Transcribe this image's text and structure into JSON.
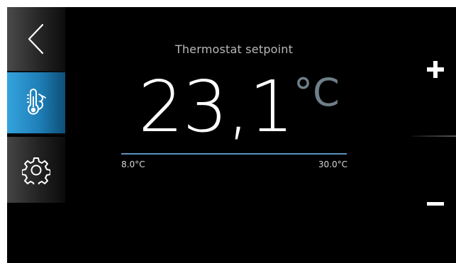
{
  "sidebar": {
    "items": [
      {
        "icon": "back-chevron-icon",
        "active": false
      },
      {
        "icon": "thermostat-icon",
        "active": true
      },
      {
        "icon": "gear-icon",
        "active": false
      }
    ]
  },
  "setpoint": {
    "title": "Thermostat setpoint",
    "value": "23,1",
    "unit": "°C",
    "min_label": "8.0°C",
    "max_label": "30.0°C"
  },
  "controls": {
    "increase_icon": "plus-icon",
    "decrease_icon": "minus-icon"
  },
  "colors": {
    "active_accent": "#2a8fcb",
    "unit_color": "#6f7f89",
    "range_track": "#5b93be"
  }
}
